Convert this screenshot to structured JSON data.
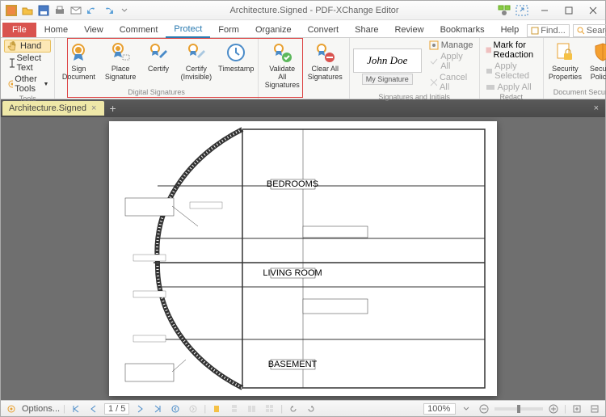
{
  "app": {
    "title": "Architecture.Signed - PDF-XChange Editor"
  },
  "menu": {
    "file": "File",
    "tabs": [
      "Home",
      "View",
      "Comment",
      "Protect",
      "Form",
      "Organize",
      "Convert",
      "Share",
      "Review",
      "Bookmarks",
      "Help"
    ],
    "active": "Protect",
    "find": "Find...",
    "search": "Search..."
  },
  "tools": {
    "hand": "Hand",
    "select": "Select Text",
    "other": "Other Tools",
    "label": "Tools"
  },
  "ribbon": {
    "sign": "Sign Document",
    "place": "Place Signature",
    "certify": "Certify",
    "certify_inv": "Certify (Invisible)",
    "timestamp": "Timestamp",
    "validate": "Validate All Signatures",
    "clear": "Clear All Signatures",
    "digsig": "Digital Signatures",
    "sig_name": "John Doe",
    "mysig": "My Signature",
    "manage": "Manage",
    "applyall": "Apply All",
    "cancelall": "Cancel All",
    "siginit": "Signatures and Initials",
    "mark": "Mark for Redaction",
    "applysel": "Apply Selected",
    "applyall2": "Apply All",
    "redact": "Redact",
    "secprop": "Security Properties",
    "secpol": "Security Policies",
    "docsec": "Document Security"
  },
  "doctab": {
    "name": "Architecture.Signed"
  },
  "drawing": {
    "bedrooms": "BEDROOMS",
    "living": "LIVING ROOM",
    "basement": "BASEMENT"
  },
  "status": {
    "options": "Options...",
    "page": "1 / 5",
    "zoom": "100%"
  }
}
